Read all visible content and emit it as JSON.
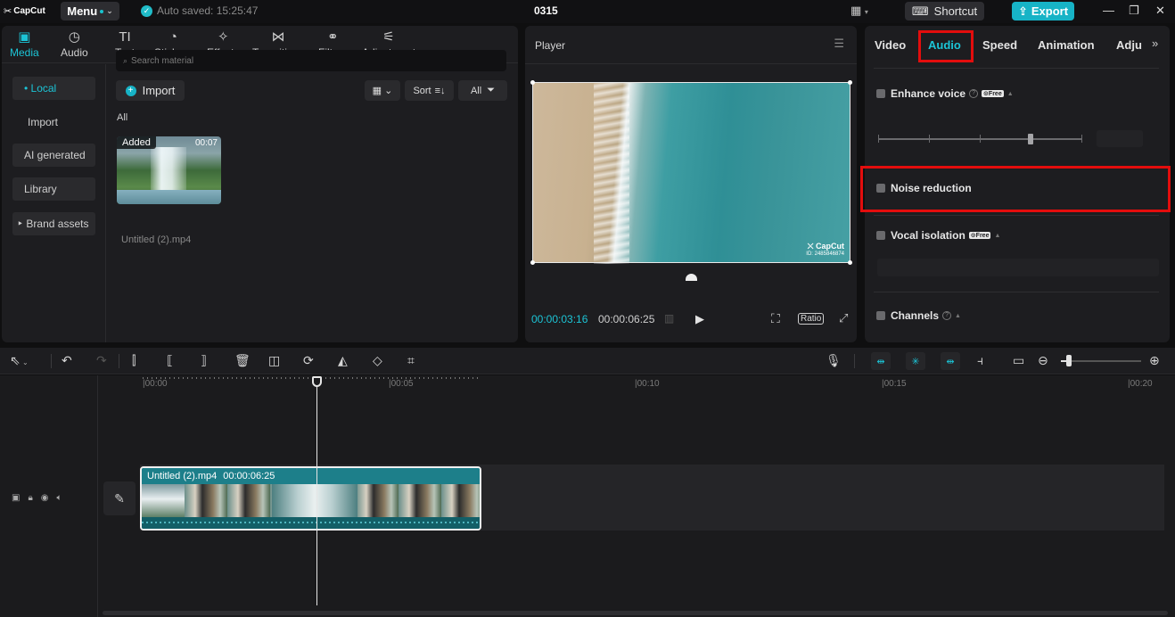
{
  "app": {
    "logo": "CapCut",
    "menu_label": "Menu",
    "autosave": "Auto saved: 15:25:47",
    "project_title": "0315",
    "shortcut_label": "Shortcut",
    "export_label": "Export"
  },
  "media_tabs": [
    {
      "label": "Media",
      "icon": "media-icon"
    },
    {
      "label": "Audio",
      "icon": "audio-icon"
    },
    {
      "label": "Text",
      "icon": "text-icon"
    },
    {
      "label": "Stickers",
      "icon": "stickers-icon"
    },
    {
      "label": "Effects",
      "icon": "effects-icon"
    },
    {
      "label": "Transitions",
      "icon": "transitions-icon"
    },
    {
      "label": "Filters",
      "icon": "filters-icon"
    },
    {
      "label": "Adjustment",
      "icon": "adjustment-icon"
    }
  ],
  "side_nav": [
    {
      "label": "• Local"
    },
    {
      "label": "Import"
    },
    {
      "label": "AI generated"
    },
    {
      "label": "Library"
    },
    {
      "label": "‣ Brand assets"
    }
  ],
  "media": {
    "search_placeholder": "Search material",
    "import_label": "Import",
    "sort_label": "Sort",
    "filter_label": "All",
    "section_label": "All",
    "item": {
      "badge": "Added",
      "duration": "00:07",
      "name": "Untitled (2).mp4"
    }
  },
  "player": {
    "title": "Player",
    "current_time": "00:00:03:16",
    "total_time": "00:00:06:25",
    "ratio_label": "Ratio",
    "watermark_brand": "CapCut",
    "watermark_id": "ID: 2485846874"
  },
  "props": {
    "tabs": [
      {
        "label": "Video"
      },
      {
        "label": "Audio"
      },
      {
        "label": "Speed"
      },
      {
        "label": "Animation"
      },
      {
        "label": "Adju"
      }
    ],
    "active_tab": "Audio",
    "free_badge": "Free",
    "options": {
      "enhance_voice": "Enhance voice",
      "noise_reduction": "Noise reduction",
      "vocal_isolation": "Vocal isolation",
      "channels": "Channels"
    }
  },
  "timeline": {
    "ruler": [
      "|00:00",
      "|00:05",
      "|00:10",
      "|00:15",
      "|00:20"
    ],
    "clip": {
      "name": "Untitled (2).mp4",
      "duration": "00:00:06:25"
    }
  },
  "colors": {
    "accent": "#1cc4d6",
    "highlight": "#e30d0d",
    "export": "#17b3c6"
  }
}
